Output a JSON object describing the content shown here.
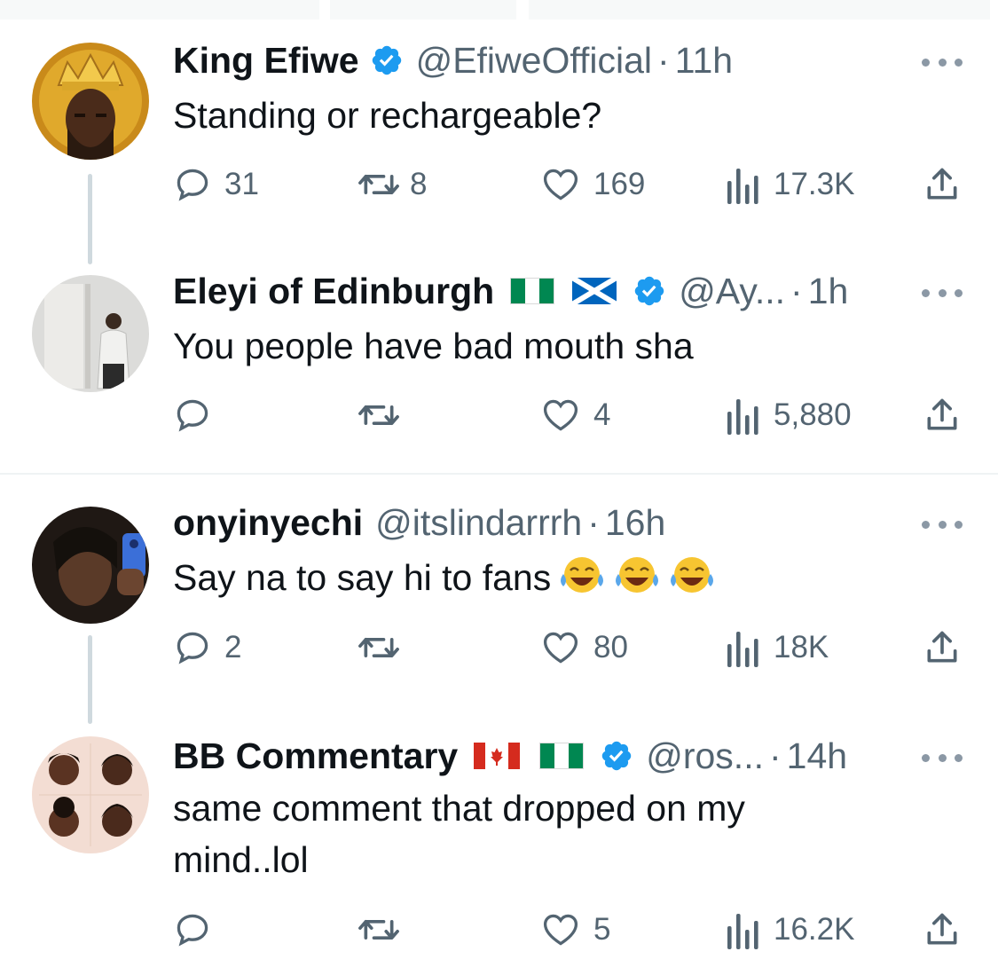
{
  "tweets": [
    {
      "name": "King Efiwe",
      "handle": "@EfiweOfficial",
      "dot": "·",
      "time": "11h",
      "text": "Standing or rechargeable?",
      "replies": "31",
      "retweets": "8",
      "likes": "169",
      "views": "17.3K"
    },
    {
      "name": "Eleyi of Edinburgh",
      "handle": "@Ay...",
      "dot": "·",
      "time": "1h",
      "text": "You people have bad mouth sha",
      "replies": "",
      "retweets": "",
      "likes": "4",
      "views": "5,880"
    },
    {
      "name": "onyinyechi",
      "handle": "@itslindarrrh",
      "dot": "·",
      "time": "16h",
      "text": "Say na to say hi to fans",
      "replies": "2",
      "retweets": "",
      "likes": "80",
      "views": "18K"
    },
    {
      "name": "BB Commentary",
      "handle": "@ros...",
      "dot": "·",
      "time": "14h",
      "text": "same comment that dropped on my mind..lol",
      "replies": "",
      "retweets": "",
      "likes": "5",
      "views": "16.2K"
    }
  ],
  "colors": {
    "text": "#0f1419",
    "secondary": "#536471",
    "verified": "#1d9bf0",
    "thread_line": "#cfd9de",
    "divider": "#eff3f4"
  },
  "icons": {
    "verified": "verified-badge-icon",
    "reply": "reply-icon",
    "retweet": "retweet-icon",
    "like": "heart-icon",
    "views": "views-bar-icon",
    "share": "share-icon",
    "more": "more-icon",
    "emoji": "tears-of-joy-emoji-icon",
    "flag_ng": "nigeria-flag-icon",
    "flag_sc": "scotland-flag-icon",
    "flag_ca": "canada-flag-icon"
  }
}
